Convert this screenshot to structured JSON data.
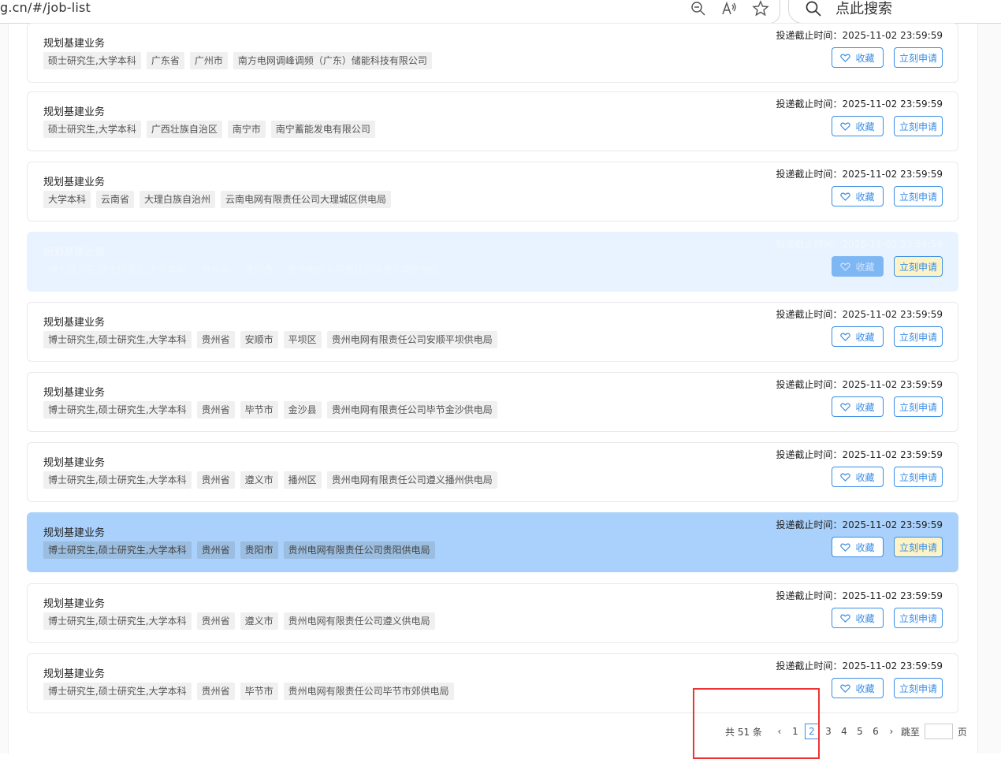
{
  "browser": {
    "url": "g.cn/#/job-list",
    "search_placeholder": "点此搜索"
  },
  "jobs": [
    {
      "title": "规划基建业务",
      "tags": [
        "硕士研究生,大学本科",
        "广东省",
        "广州市",
        "南方电网调峰调频（广东）储能科技有限公司"
      ],
      "deadline": "投递截止时间：2025-11-02 23:59:59",
      "fav": "收藏",
      "apply": "立刻申请"
    },
    {
      "title": "规划基建业务",
      "tags": [
        "硕士研究生,大学本科",
        "广西壮族自治区",
        "南宁市",
        "南宁蓄能发电有限公司"
      ],
      "deadline": "投递截止时间：2025-11-02 23:59:59",
      "fav": "收藏",
      "apply": "立刻申请"
    },
    {
      "title": "规划基建业务",
      "tags": [
        "大学本科",
        "云南省",
        "大理白族自治州",
        "云南电网有限责任公司大理城区供电局"
      ],
      "deadline": "投递截止时间：2025-11-02 23:59:59",
      "fav": "收藏",
      "apply": "立刻申请"
    },
    {
      "title": "规划基建业务",
      "tags": [
        "博士研究生,硕士研究生,大学本科",
        "贵州省",
        "贵阳市",
        "贵州电网有限责任公司贵阳南供电局"
      ],
      "deadline": "投递截止时间：2025-11-02 23:59:59",
      "fav": "收藏",
      "apply": "立刻申请"
    },
    {
      "title": "规划基建业务",
      "tags": [
        "博士研究生,硕士研究生,大学本科",
        "贵州省",
        "安顺市",
        "平坝区",
        "贵州电网有限责任公司安顺平坝供电局"
      ],
      "deadline": "投递截止时间：2025-11-02 23:59:59",
      "fav": "收藏",
      "apply": "立刻申请"
    },
    {
      "title": "规划基建业务",
      "tags": [
        "博士研究生,硕士研究生,大学本科",
        "贵州省",
        "毕节市",
        "金沙县",
        "贵州电网有限责任公司毕节金沙供电局"
      ],
      "deadline": "投递截止时间：2025-11-02 23:59:59",
      "fav": "收藏",
      "apply": "立刻申请"
    },
    {
      "title": "规划基建业务",
      "tags": [
        "博士研究生,硕士研究生,大学本科",
        "贵州省",
        "遵义市",
        "播州区",
        "贵州电网有限责任公司遵义播州供电局"
      ],
      "deadline": "投递截止时间：2025-11-02 23:59:59",
      "fav": "收藏",
      "apply": "立刻申请"
    },
    {
      "title": "规划基建业务",
      "tags": [
        "博士研究生,硕士研究生,大学本科",
        "贵州省",
        "贵阳市",
        "贵州电网有限责任公司贵阳供电局"
      ],
      "deadline": "投递截止时间：2025-11-02 23:59:59",
      "fav": "收藏",
      "apply": "立刻申请"
    },
    {
      "title": "规划基建业务",
      "tags": [
        "博士研究生,硕士研究生,大学本科",
        "贵州省",
        "遵义市",
        "贵州电网有限责任公司遵义供电局"
      ],
      "deadline": "投递截止时间：2025-11-02 23:59:59",
      "fav": "收藏",
      "apply": "立刻申请"
    },
    {
      "title": "规划基建业务",
      "tags": [
        "博士研究生,硕士研究生,大学本科",
        "贵州省",
        "毕节市",
        "贵州电网有限责任公司毕节市郊供电局"
      ],
      "deadline": "投递截止时间：2025-11-02 23:59:59",
      "fav": "收藏",
      "apply": "立刻申请"
    }
  ],
  "pagination": {
    "total": "共 51 条",
    "prev": "‹",
    "pages": [
      "1",
      "2",
      "3",
      "4",
      "5",
      "6"
    ],
    "current_page": "2",
    "next": "›",
    "jump_label": "跳至",
    "page_suffix": "页"
  },
  "colors": {
    "accent": "#3a8ee6",
    "active_row": "#a9d1fb",
    "highlight_box": "#e33333"
  }
}
